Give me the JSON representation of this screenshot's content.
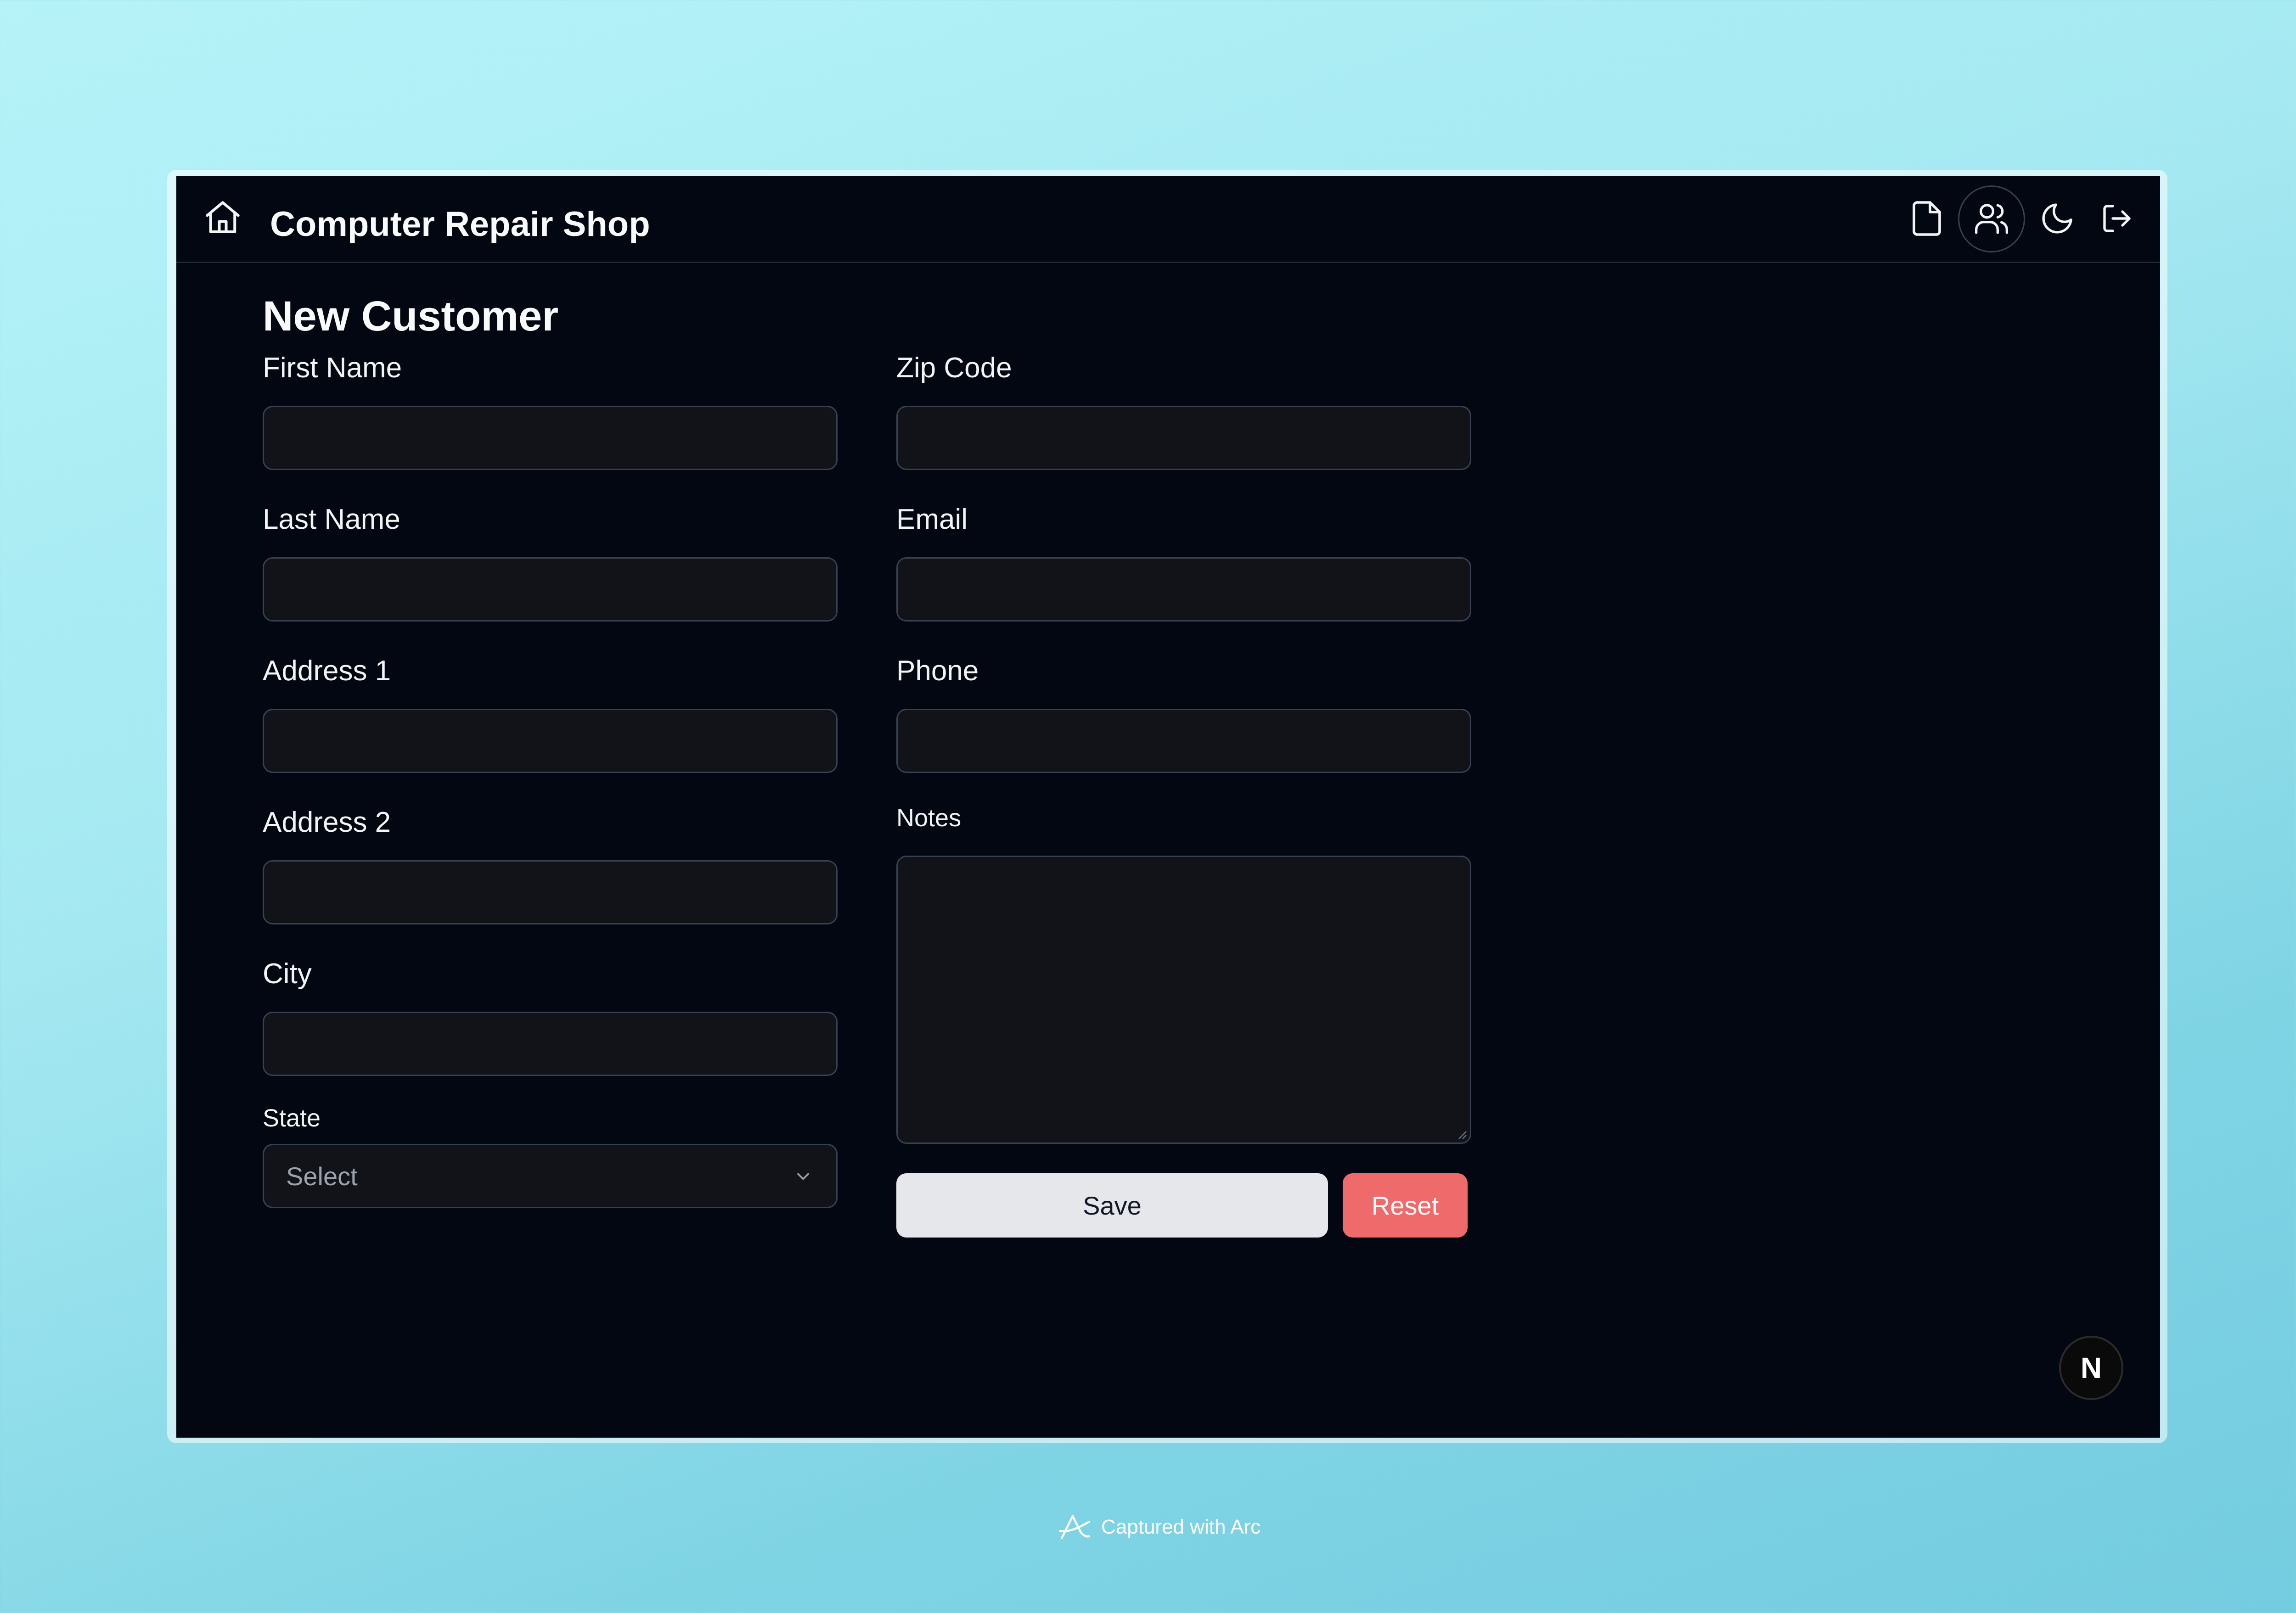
{
  "app": {
    "title": "Computer Repair Shop",
    "icons": [
      "home-icon",
      "file-icon",
      "users-icon",
      "moon-icon",
      "logout-icon"
    ]
  },
  "page": {
    "title": "New Customer"
  },
  "form": {
    "left": [
      {
        "label": "First Name",
        "value": ""
      },
      {
        "label": "Last Name",
        "value": ""
      },
      {
        "label": "Address 1",
        "value": ""
      },
      {
        "label": "Address 2",
        "value": ""
      },
      {
        "label": "City",
        "value": ""
      }
    ],
    "state": {
      "label": "State",
      "selected": "Select"
    },
    "right": [
      {
        "label": "Zip Code",
        "value": ""
      },
      {
        "label": "Email",
        "value": ""
      },
      {
        "label": "Phone",
        "value": ""
      }
    ],
    "notes": {
      "label": "Notes",
      "value": ""
    },
    "buttons": {
      "save": "Save",
      "reset": "Reset"
    }
  },
  "badge": {
    "letter": "N"
  },
  "footer": {
    "caption": "Captured with Arc"
  },
  "colors": {
    "background_gradient_start": "#b5f3f8",
    "background_gradient_end": "#74cce0",
    "window_bg": "#030712",
    "input_bg": "#111318",
    "save_bg": "#e5e7eb",
    "reset_bg": "#ef6b6b"
  }
}
